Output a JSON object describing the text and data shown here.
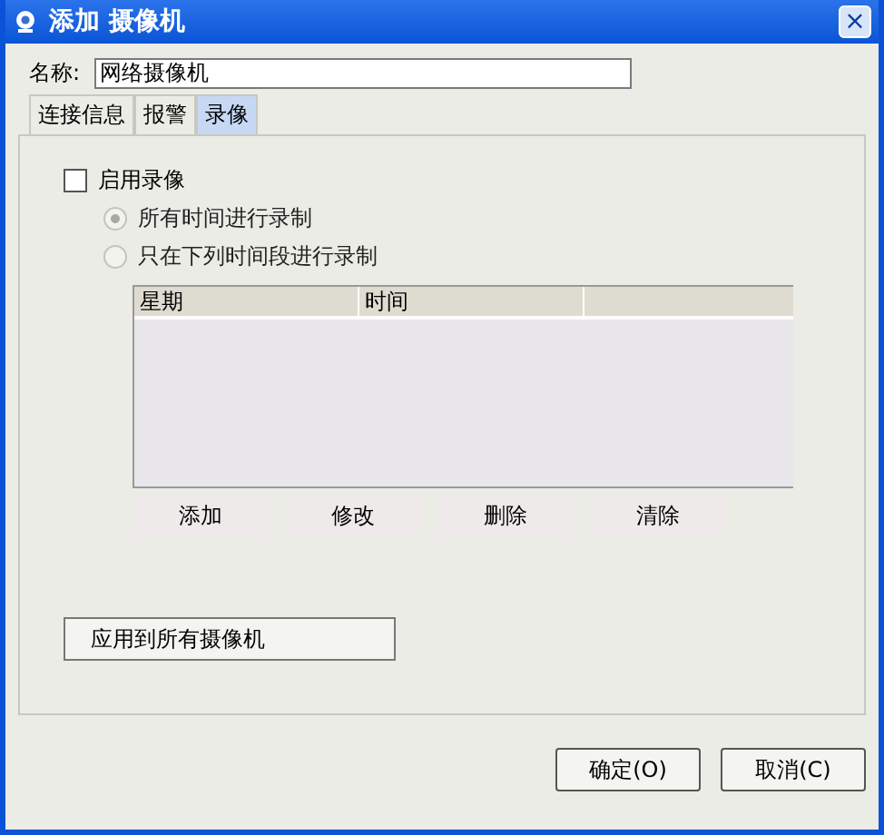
{
  "window": {
    "title": "添加 摄像机",
    "close": "×"
  },
  "name_field": {
    "label": "名称:",
    "value": "网络摄像机"
  },
  "tabs": [
    {
      "label": "连接信息",
      "selected": false
    },
    {
      "label": "报警",
      "selected": false
    },
    {
      "label": "录像",
      "selected": true
    }
  ],
  "enable_recording": {
    "label": "启用录像",
    "checked": false
  },
  "radios": [
    {
      "label": "所有时间进行录制",
      "selected": true,
      "disabled": true
    },
    {
      "label": "只在下列时间段进行录制",
      "selected": false,
      "disabled": true
    }
  ],
  "table": {
    "columns": [
      "星期",
      "时间"
    ]
  },
  "table_buttons": [
    "添加",
    "修改",
    "删除",
    "清除"
  ],
  "apply_button": "应用到所有摄像机",
  "buttons": [
    "确定(O)",
    "取消(C)"
  ]
}
